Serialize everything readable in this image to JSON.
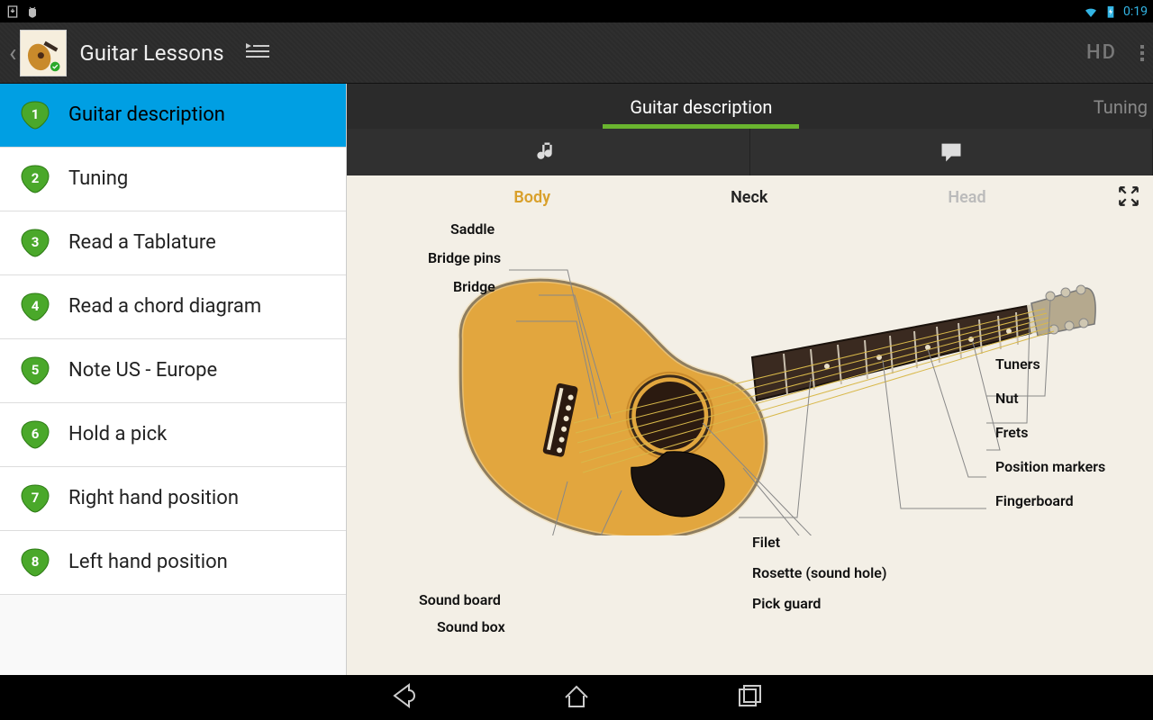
{
  "statusbar": {
    "time": "0:19"
  },
  "actionbar": {
    "title": "Guitar Lessons",
    "hd_label": "HD"
  },
  "sidebar": {
    "items": [
      {
        "num": "1",
        "label": "Guitar description",
        "active": true
      },
      {
        "num": "2",
        "label": "Tuning"
      },
      {
        "num": "3",
        "label": "Read a Tablature"
      },
      {
        "num": "4",
        "label": "Read a chord diagram"
      },
      {
        "num": "5",
        "label": "Note US - Europe"
      },
      {
        "num": "6",
        "label": "Hold a pick"
      },
      {
        "num": "7",
        "label": "Right hand position"
      },
      {
        "num": "8",
        "label": "Left hand position"
      }
    ]
  },
  "tabs": {
    "active": "Guitar description",
    "next": "Tuning"
  },
  "diagram": {
    "sections": {
      "body": "Body",
      "neck": "Neck",
      "head": "Head"
    },
    "labels_left": {
      "saddle": "Saddle",
      "bridge_pins": "Bridge pins",
      "bridge": "Bridge",
      "sound_board": "Sound board",
      "sound_box": "Sound box"
    },
    "labels_mid": {
      "filet": "Filet",
      "rosette": "Rosette (sound hole)",
      "pick_guard": "Pick guard"
    },
    "labels_right": {
      "tuners": "Tuners",
      "nut": "Nut",
      "frets": "Frets",
      "position_markers": "Position markers",
      "fingerboard": "Fingerboard"
    }
  }
}
